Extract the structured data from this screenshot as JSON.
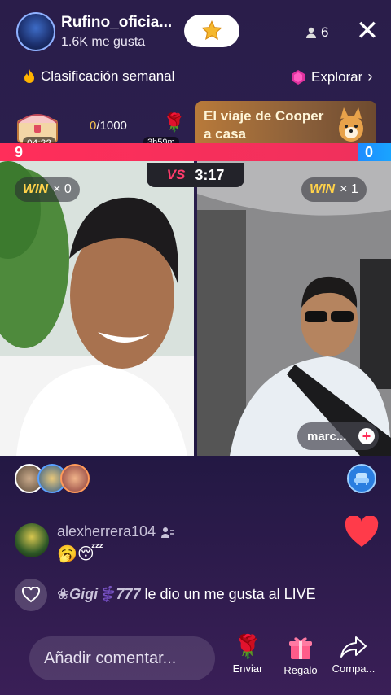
{
  "header": {
    "host_name": "Rufino_oficia...",
    "host_likes": "1.6K me gusta",
    "viewers_count": "6"
  },
  "banners": {
    "weekly_ranking": "Clasificación semanal",
    "explore": "Explorar"
  },
  "chest": {
    "timer": "04:22"
  },
  "progress": {
    "current": "0",
    "total": "/1000",
    "timer": "3h59m"
  },
  "promo": {
    "text": "El viaje de Cooper a casa"
  },
  "battle": {
    "score_left": "9",
    "score_right": "0",
    "vs_label": "VS",
    "timer": "3:17",
    "left_win_word": "WIN",
    "left_wins": "× 0",
    "right_win_word": "WIN",
    "right_wins": "× 1",
    "guest_name": "marc..."
  },
  "comment": {
    "username": "alexherrera104",
    "emojis": "🥱😴"
  },
  "like_event": {
    "user": "❀Gigi⚕️777",
    "text": "le dio un me gusta al LIVE"
  },
  "bottom": {
    "comment_placeholder": "Añadir comentar...",
    "send_label": "Enviar",
    "gift_label": "Regalo",
    "share_label": "Compa..."
  },
  "colors": {
    "accent_red": "#ff2e5a",
    "accent_blue": "#1e8cff",
    "win_gold": "#ffd24a"
  }
}
